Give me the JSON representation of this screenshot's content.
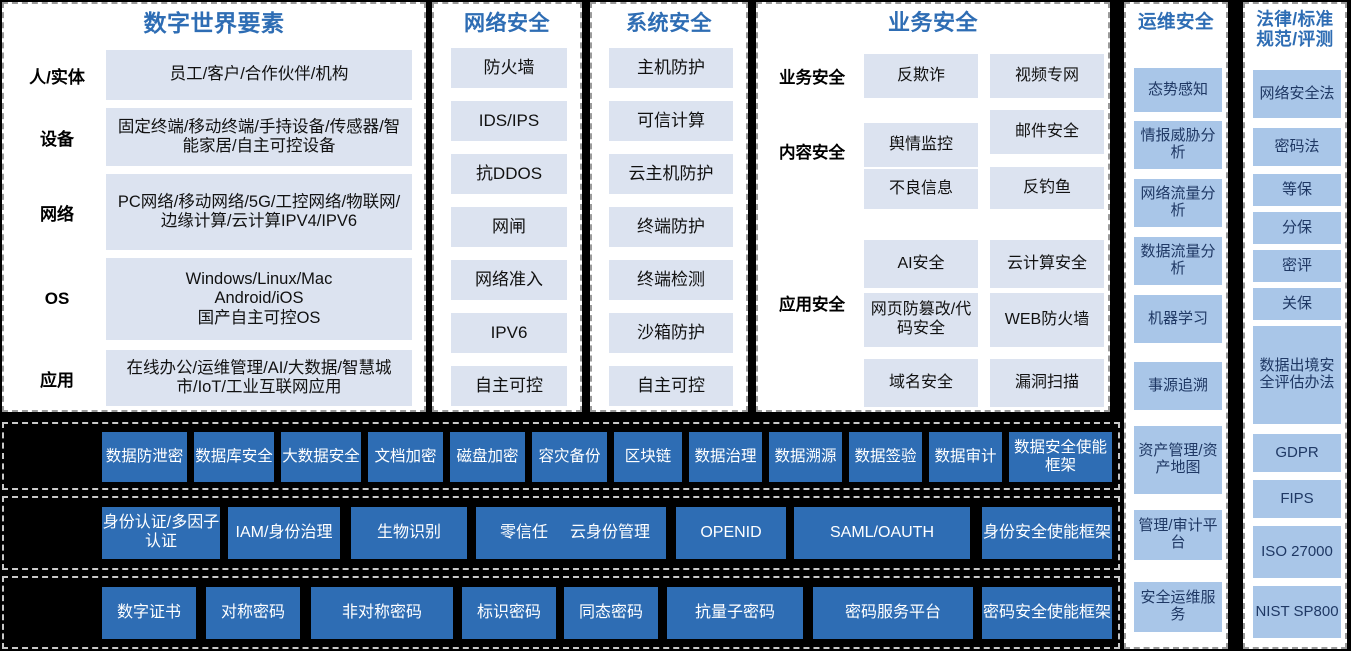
{
  "theme": {
    "accent": "#2E6DB4",
    "chip_light": "#DCE3F0",
    "chip_mid": "#A9C6E8",
    "band_bg": "#000000",
    "panel_bg": "#FFFFFF"
  },
  "panels": {
    "digital_world": {
      "title": "数字世界要素",
      "rows": [
        {
          "label": "人/实体",
          "value": "员工/客户/合作伙伴/机构"
        },
        {
          "label": "设备",
          "value": "固定终端/移动终端/手持设备/传感器/智能家居/自主可控设备"
        },
        {
          "label": "网络",
          "value": "PC网络/移动网络/5G/工控网络/物联网/边缘计算/云计算IPV4/IPV6"
        },
        {
          "label": "OS",
          "value": "Windows/Linux/Mac\nAndroid/iOS\n国产自主可控OS"
        },
        {
          "label": "应用",
          "value": "在线办公/运维管理/AI/大数据/智慧城市/IoT/工业互联网应用"
        }
      ]
    },
    "network_security": {
      "title": "网络安全",
      "items": [
        "防火墙",
        "IDS/IPS",
        "抗DDOS",
        "网闸",
        "网络准入",
        "IPV6",
        "自主可控"
      ]
    },
    "system_security": {
      "title": "系统安全",
      "items": [
        "主机防护",
        "可信计算",
        "云主机防护",
        "终端防护",
        "终端检测",
        "沙箱防护",
        "自主可控"
      ]
    },
    "business_security": {
      "title": "业务安全",
      "groups": [
        {
          "label": "业务安全",
          "left": [
            "反欺诈"
          ],
          "right": [
            "视频专网"
          ]
        },
        {
          "label": "内容安全",
          "left": [
            "舆情监控",
            "不良信息"
          ],
          "right": [
            "邮件安全",
            "反钓鱼"
          ]
        },
        {
          "label": "应用安全",
          "left": [
            "AI安全",
            "网页防篡改/代码安全",
            "域名安全"
          ],
          "right": [
            "云计算安全",
            "WEB防火墙",
            "漏洞扫描"
          ]
        }
      ]
    },
    "ops_security": {
      "title": "运维安全",
      "items": [
        "态势感知",
        "情报威胁分析",
        "网络流量分析",
        "数据流量分析",
        "机器学习",
        "事源追溯",
        "资产管理/资产地图",
        "管理/审计平台",
        "安全运维服务"
      ]
    },
    "law_standards": {
      "title": "法律/标准\n规范/评测",
      "items": [
        "网络安全法",
        "密码法",
        "等保",
        "分保",
        "密评",
        "关保",
        "数据出境安全评估办法",
        "GDPR",
        "FIPS",
        "ISO 27000",
        "NIST SP800"
      ]
    }
  },
  "bands": [
    {
      "name": "data_security",
      "items": [
        "数据防泄密",
        "数据库安全",
        "大数据安全",
        "文档加密",
        "磁盘加密",
        "容灾备份",
        "区块链",
        "数据治理",
        "数据溯源",
        "数据签验",
        "数据审计",
        "数据安全使能框架"
      ]
    },
    {
      "name": "identity_security",
      "items": [
        "身份认证/多因子认证",
        "IAM/身份治理",
        "生物识别",
        "零信任",
        "云身份管理",
        "OPENID",
        "SAML/OAUTH",
        "身份安全使能框架"
      ]
    },
    {
      "name": "crypto_security",
      "items": [
        "数字证书",
        "对称密码",
        "非对称密码",
        "标识密码",
        "同态密码",
        "抗量子密码",
        "密码服务平台",
        "密码安全使能框架"
      ]
    }
  ]
}
